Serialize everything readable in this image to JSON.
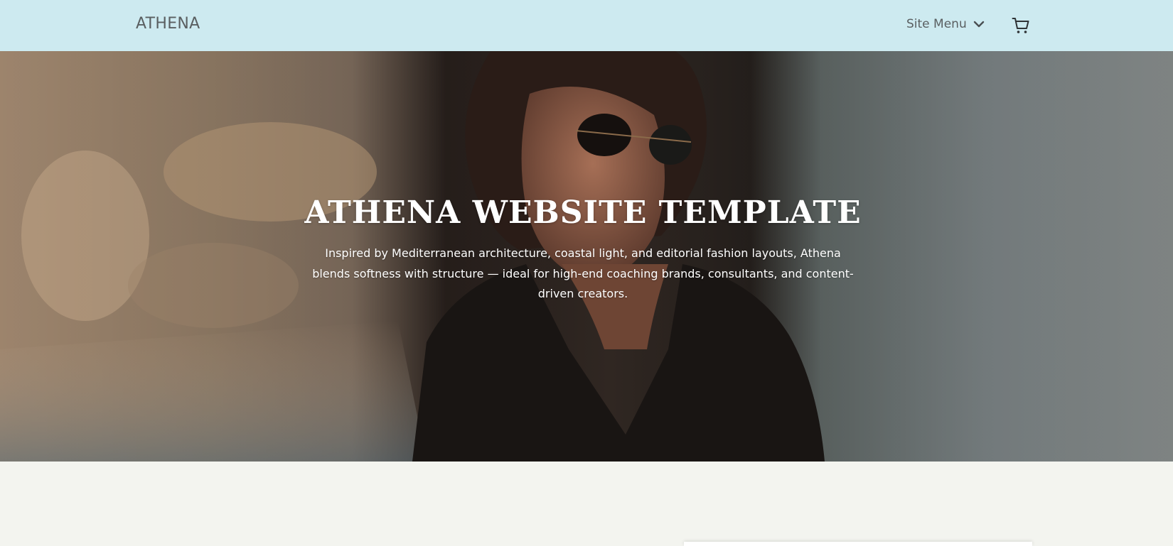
{
  "header": {
    "logo": "ATHENA",
    "menu_label": "Site Menu",
    "menu_icon": "chevron-down-icon",
    "cart_icon": "cart-icon",
    "background": "#cdeaf0"
  },
  "hero": {
    "title": "ATHENA WEBSITE TEMPLATE",
    "description": "Inspired by Mediterranean architecture, coastal light, and editorial fashion layouts, Athena blends softness with structure — ideal for high-end coaching brands, consultants, and content-driven creators.",
    "text_color": "#ffffff"
  },
  "page": {
    "background": "#f3f4ef"
  }
}
